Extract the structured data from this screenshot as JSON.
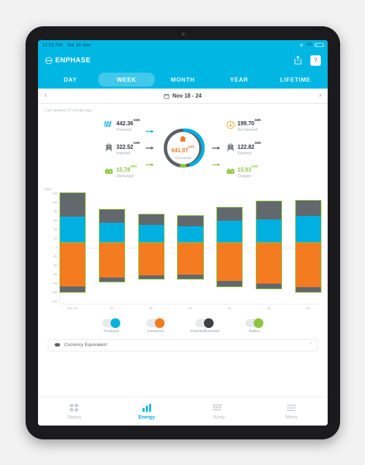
{
  "status_bar": {
    "time": "12:52 PM",
    "date": "Sat 30 Nov",
    "wifi_icon": "wifi-icon",
    "battery_percent": "4%",
    "battery_icon": "battery-icon"
  },
  "app_bar": {
    "brand_icon": "enphase-logo-icon",
    "brand": "ENPHASE",
    "share_icon": "share-icon",
    "help_label": "?"
  },
  "period_tabs": {
    "items": [
      {
        "label": "DAY",
        "active": false
      },
      {
        "label": "WEEK",
        "active": true
      },
      {
        "label": "MONTH",
        "active": false
      },
      {
        "label": "YEAR",
        "active": false
      },
      {
        "label": "LIFETIME",
        "active": false
      }
    ]
  },
  "date_nav": {
    "prev_icon": "chevron-left-icon",
    "next_icon": "chevron-right-icon",
    "calendar_icon": "calendar-icon",
    "range": "Nov 18 - 24"
  },
  "updated_text": "Last Updated 22 minutes ago",
  "energy_flow": {
    "left": [
      {
        "icon": "solar-panel-icon",
        "value": "442.36",
        "unit": "kWh",
        "label": "Produced",
        "color": "#2e3338",
        "arrow_color": "#00b0e0"
      },
      {
        "icon": "grid-tower-icon",
        "value": "322.52",
        "unit": "kWh",
        "label": "Imported",
        "color": "#2e3338",
        "arrow_color": "#4c5256"
      },
      {
        "icon": "battery-pack-icon",
        "value": "15.78",
        "unit": "kWh",
        "label": "Discharged",
        "color": "#8cc63f",
        "arrow_color": "#8cc63f"
      }
    ],
    "center": {
      "icon": "house-icon",
      "value": "641.97",
      "unit": "kWh",
      "label": "Consumed",
      "ring_colors": {
        "consumed_cyan": "#00b0e0",
        "grid_gray": "#5b6166",
        "battery_green": "#8cc63f"
      }
    },
    "right": [
      {
        "icon": "net-imported-icon",
        "value": "199.70",
        "unit": "kWh",
        "label": "Net Imported",
        "color": "#2e3338",
        "arrow_color": ""
      },
      {
        "icon": "grid-tower-icon",
        "value": "122.82",
        "unit": "kWh",
        "label": "Exported",
        "color": "#2e3338",
        "arrow_color": "#4c5256"
      },
      {
        "icon": "battery-pack-icon",
        "value": "15.93",
        "unit": "kWh",
        "label": "Charged",
        "color": "#8cc63f",
        "arrow_color": "#8cc63f"
      }
    ]
  },
  "chart_data": {
    "type": "bar",
    "title": "",
    "subtitle": "",
    "xlabel": "",
    "ylabel": "kWh",
    "unit_label": "kWh",
    "stacked": true,
    "grid": false,
    "legend_position": "bottom",
    "ylim": [
      -120,
      120
    ],
    "yticks": [
      120,
      100,
      80,
      60,
      40,
      20,
      0,
      -20,
      -40,
      -60,
      -80,
      -100,
      -120
    ],
    "categories": [
      "Nov 18",
      "19",
      "20",
      "21",
      "22",
      "23",
      "24"
    ],
    "series": [
      {
        "name": "Produced",
        "color": "#00b0e0",
        "sign": "positive",
        "values": [
          62,
          48,
          42,
          40,
          52,
          56,
          64
        ]
      },
      {
        "name": "Imported",
        "color": "#63686c",
        "sign": "positive",
        "values": [
          55,
          30,
          25,
          24,
          32,
          42,
          36
        ]
      },
      {
        "name": "Consumed",
        "color": "#f47b20",
        "sign": "negative",
        "values": [
          102,
          82,
          76,
          75,
          90,
          96,
          104
        ]
      },
      {
        "name": "Exported",
        "color": "#63686c",
        "sign": "negative",
        "values": [
          14,
          10,
          9,
          9,
          13,
          12,
          12
        ]
      }
    ]
  },
  "legend": {
    "items": [
      {
        "label": "Produced",
        "color": "#00b0e0",
        "on": true
      },
      {
        "label": "Consumed",
        "color": "#f47b20",
        "on": true
      },
      {
        "label": "Imported/Exported",
        "color": "#3d4145",
        "on": true
      },
      {
        "label": "Battery",
        "color": "#8cc63f",
        "on": true
      }
    ]
  },
  "currency_row": {
    "icon": "coin-stack-icon",
    "label": "Currency Equivalent",
    "chevron_icon": "chevron-up-icon"
  },
  "bottom_nav": {
    "items": [
      {
        "label": "Status",
        "icon": "grid-squares-icon",
        "active": false
      },
      {
        "label": "Energy",
        "icon": "bar-chart-icon",
        "active": true
      },
      {
        "label": "Array",
        "icon": "solar-array-icon",
        "active": false
      },
      {
        "label": "Menu",
        "icon": "hamburger-menu-icon",
        "active": false
      }
    ]
  },
  "theme": {
    "accent": "#00b7e4",
    "produced": "#00b0e0",
    "consumed": "#f47b20",
    "grid": "#63686c",
    "battery": "#8cc63f"
  }
}
